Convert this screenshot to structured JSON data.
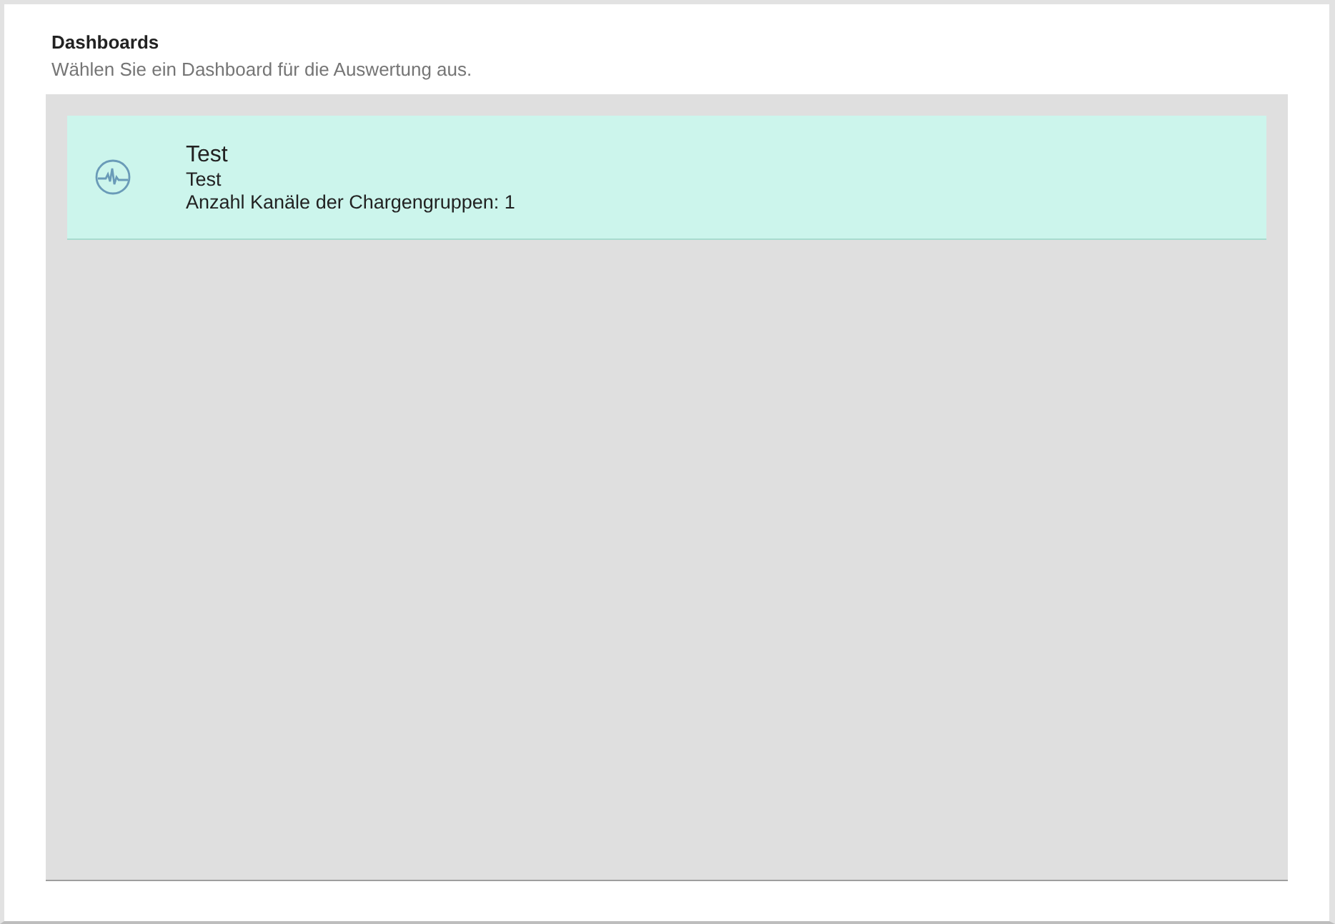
{
  "header": {
    "title": "Dashboards",
    "subtitle": "Wählen Sie ein Dashboard für die Auswertung aus."
  },
  "dashboards": [
    {
      "title": "Test",
      "description": "Test",
      "info": "Anzahl Kanäle der Chargengruppen: 1",
      "selected": true
    }
  ]
}
